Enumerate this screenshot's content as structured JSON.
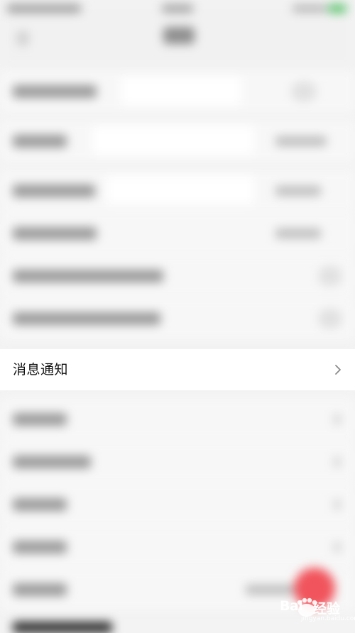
{
  "settings_list": {
    "highlighted_item": {
      "label": "消息通知",
      "chevron_icon": "chevron-right-icon"
    }
  },
  "watermark": {
    "brand": "Bai",
    "brand_suffix": "经验",
    "url": "jingyan.baidu.com"
  },
  "colors": {
    "accent_red": "#f1545c",
    "status_green": "#59c26a"
  }
}
